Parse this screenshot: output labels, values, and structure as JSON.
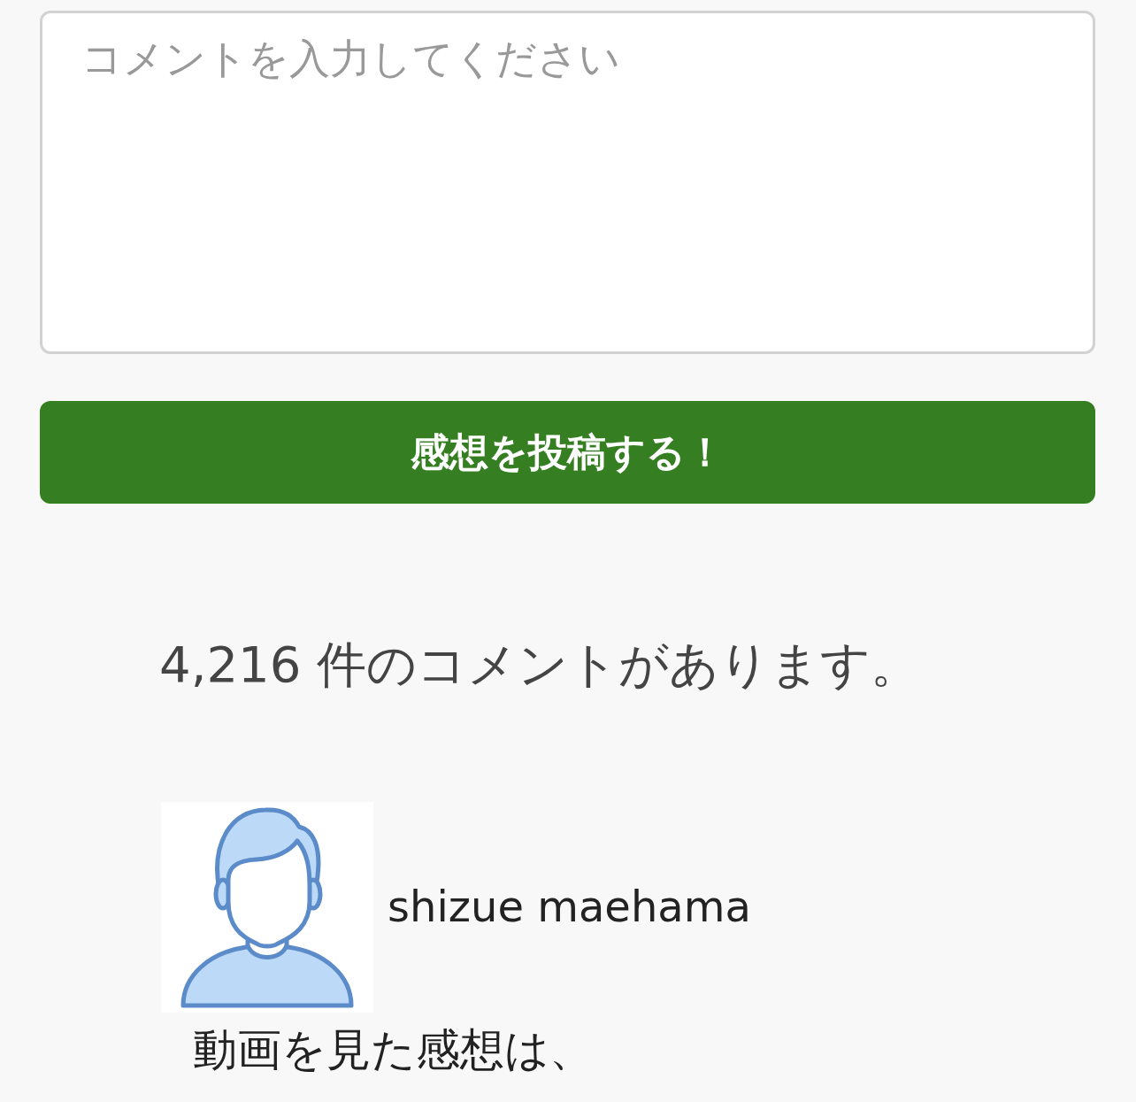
{
  "comment_form": {
    "textarea": {
      "placeholder": "コメントを入力してください"
    },
    "submit_button": "感想を投稿する！"
  },
  "comment_count": "4,216 件のコメントがあります。",
  "comments": [
    {
      "author": "shizue maehama",
      "text": "動画を見た感想は、"
    }
  ]
}
